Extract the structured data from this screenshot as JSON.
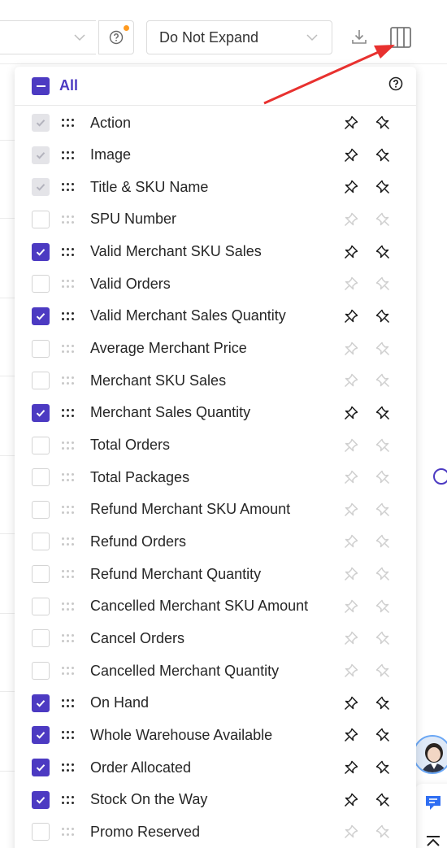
{
  "toolbar": {
    "expand_select_value": "Do Not Expand",
    "help_badge_color": "#ff9a1f"
  },
  "panel": {
    "all_label": "All",
    "accent_color": "#4c3ac2",
    "columns": [
      {
        "label": "Action",
        "state": "disabled"
      },
      {
        "label": "Image",
        "state": "disabled"
      },
      {
        "label": "Title & SKU Name",
        "state": "disabled"
      },
      {
        "label": "SPU Number",
        "state": "unchecked"
      },
      {
        "label": "Valid Merchant SKU Sales",
        "state": "checked"
      },
      {
        "label": "Valid Orders",
        "state": "unchecked"
      },
      {
        "label": "Valid Merchant Sales Quantity",
        "state": "checked"
      },
      {
        "label": "Average Merchant Price",
        "state": "unchecked"
      },
      {
        "label": "Merchant SKU Sales",
        "state": "unchecked"
      },
      {
        "label": "Merchant Sales Quantity",
        "state": "checked"
      },
      {
        "label": "Total Orders",
        "state": "unchecked"
      },
      {
        "label": "Total Packages",
        "state": "unchecked"
      },
      {
        "label": "Refund Merchant SKU Amount",
        "state": "unchecked"
      },
      {
        "label": "Refund Orders",
        "state": "unchecked"
      },
      {
        "label": "Refund Merchant Quantity",
        "state": "unchecked"
      },
      {
        "label": "Cancelled Merchant SKU Amount",
        "state": "unchecked"
      },
      {
        "label": "Cancel Orders",
        "state": "unchecked"
      },
      {
        "label": "Cancelled Merchant Quantity",
        "state": "unchecked"
      },
      {
        "label": "On Hand",
        "state": "checked"
      },
      {
        "label": "Whole Warehouse Available",
        "state": "checked"
      },
      {
        "label": "Order Allocated",
        "state": "checked"
      },
      {
        "label": "Stock On the Way",
        "state": "checked"
      },
      {
        "label": "Promo Reserved",
        "state": "unchecked"
      }
    ]
  },
  "icons": {
    "help": "question-circle-icon",
    "download": "download-icon",
    "columns": "columns-icon",
    "pin": "pin-icon",
    "unpin": "unpin-icon",
    "chat": "chat-icon",
    "back_to_top": "back-to-top-icon"
  }
}
